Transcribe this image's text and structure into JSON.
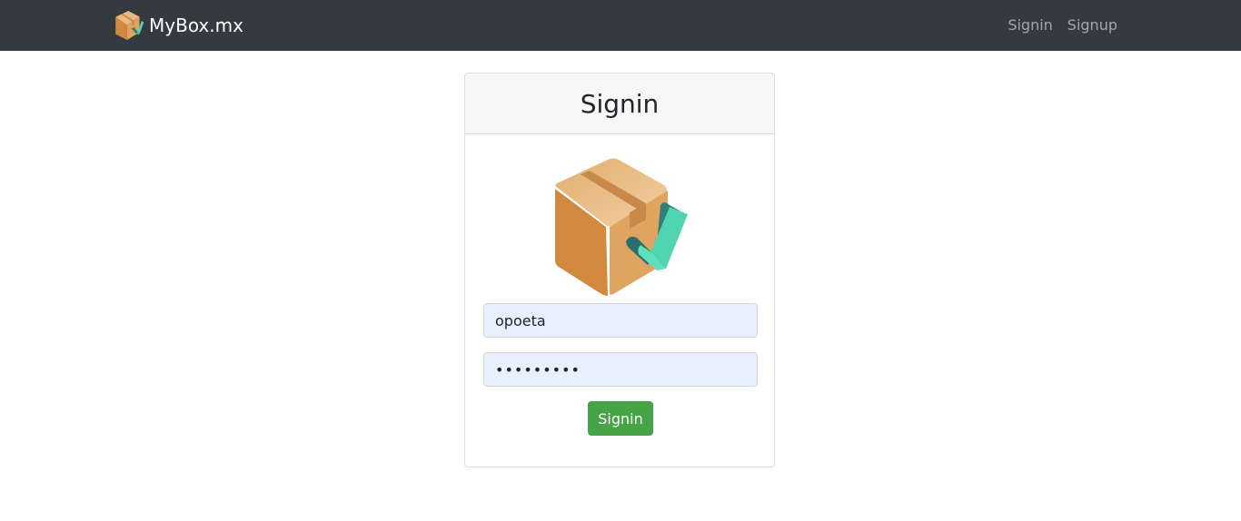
{
  "app": {
    "brand_name": "MyBox.mx",
    "brand_icon": "box-check-icon"
  },
  "nav": {
    "items": [
      {
        "label": "Signin"
      },
      {
        "label": "Signup"
      }
    ]
  },
  "signin_card": {
    "title": "Signin",
    "logo_icon": "box-check-icon",
    "username": {
      "value": "opoeta",
      "placeholder": ""
    },
    "password": {
      "value": "•••••••••",
      "placeholder": ""
    },
    "submit_label": "Signin"
  },
  "colors": {
    "navbar": "#343a40",
    "button": "#46a346",
    "autofill": "#e8f0fe",
    "box": "#dfa460",
    "check": "#4fd3b0"
  }
}
